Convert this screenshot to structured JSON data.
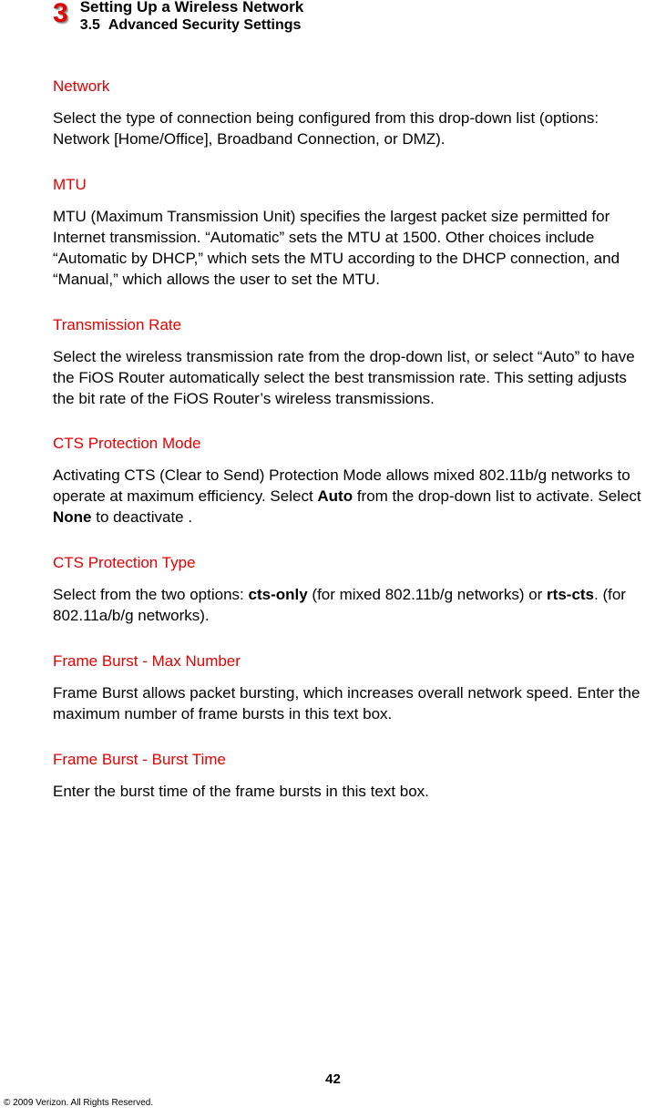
{
  "header": {
    "chapter_num": "3",
    "chapter_title": "Setting Up a Wireless Network",
    "section_num": "3.5",
    "section_name": "Advanced Security Settings"
  },
  "sections": {
    "network": {
      "heading": "Network",
      "body": "Select the type of connection being configured from this drop-down list (options: Network [Home/Office], Broadband Connection, or DMZ)."
    },
    "mtu": {
      "heading": "MTU",
      "body": "MTU (Maximum Transmission Unit) specifies the largest packet size permitted for Internet transmission. “Automatic” sets the MTU at 1500. Other choices include “Automatic by DHCP,” which sets the MTU according to the DHCP connection, and “Manual,” which allows the user to set the MTU."
    },
    "trans_rate": {
      "heading": "Transmission Rate",
      "body": "Select the wireless transmission rate from the drop-down list, or select “Auto” to have the FiOS Router automatically select the best transmission rate. This setting adjusts the bit rate of the FiOS Router’s wireless transmissions."
    },
    "cts_mode": {
      "heading": "CTS Protection Mode",
      "body_pre": "Activating CTS (Clear to Send) Protection Mode allows mixed 802.11b/g networks to operate at maximum efficiency. Select ",
      "bold1": "Auto",
      "body_mid": " from the drop-down list to activate. Select ",
      "bold2": "None",
      "body_post": " to deactivate ."
    },
    "cts_type": {
      "heading": "CTS Protection Type",
      "body_pre": "Select from the two options: ",
      "bold1": "cts-only",
      "body_mid": " (for mixed 802.11b/g networks) or ",
      "bold2": "rts-cts",
      "body_post": ". (for 802.11a/b/g networks)."
    },
    "fb_max": {
      "heading": "Frame Burst - Max Number",
      "body": "Frame Burst allows packet bursting, which increases overall network speed. Enter the maximum number of frame bursts in this text box."
    },
    "fb_time": {
      "heading": "Frame Burst - Burst Time",
      "body": "Enter the burst time of the frame bursts in this text box."
    }
  },
  "page_number": "42",
  "copyright": "© 2009 Verizon. All Rights Reserved."
}
